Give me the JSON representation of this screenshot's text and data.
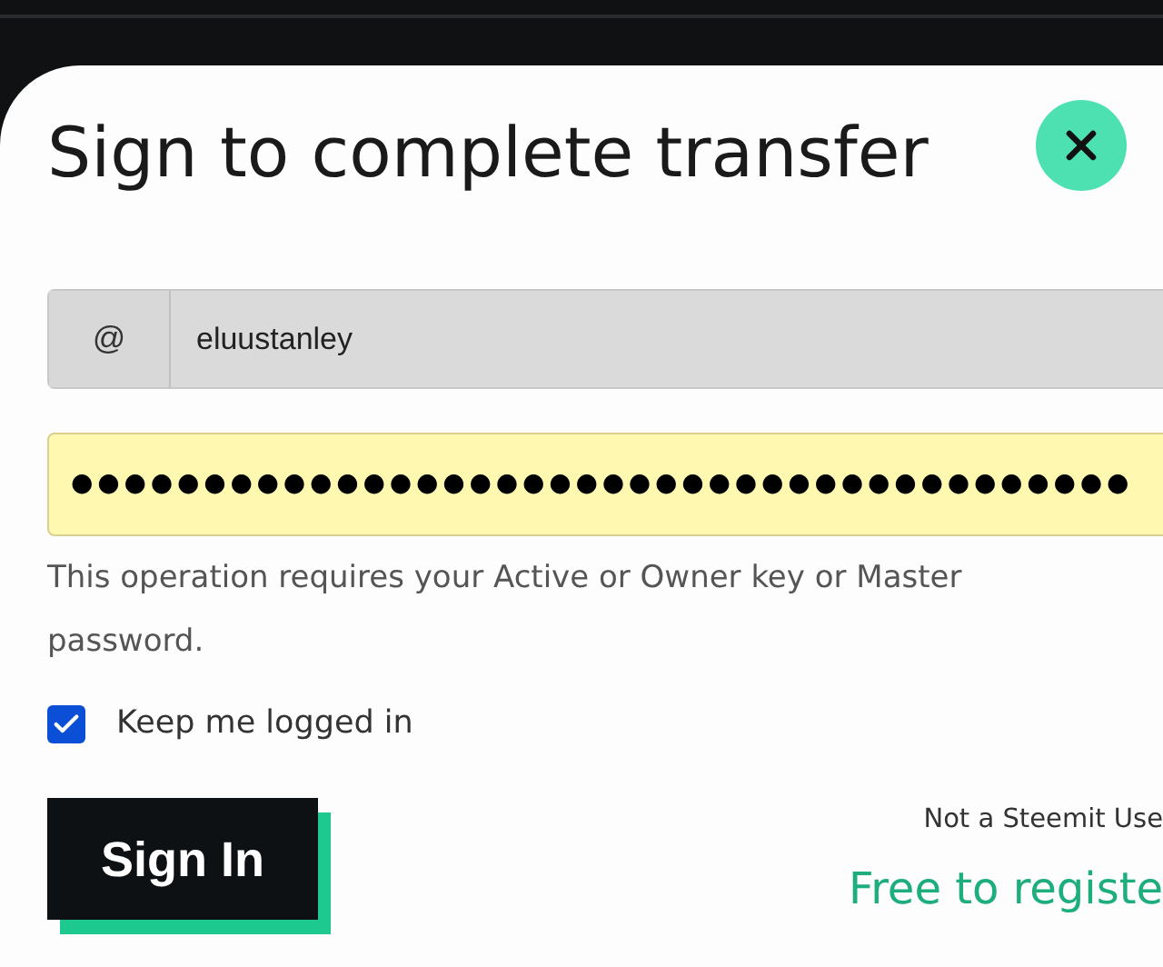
{
  "dialog": {
    "title": "Sign to complete transfer",
    "username": {
      "prefix": "@",
      "value": "eluustanley"
    },
    "password": {
      "value": "●●●●●●●●●●●●●●●●●●●●●●●●●●●●●●●●●●●●●●●●"
    },
    "help_text": "This operation requires your Active or Owner key or Master password.",
    "keep_logged_in": {
      "label": "Keep me logged in",
      "checked": true
    },
    "sign_in_button": "Sign In",
    "register_prompt": "Not a Steemit Use",
    "register_link": "Free to registe"
  }
}
